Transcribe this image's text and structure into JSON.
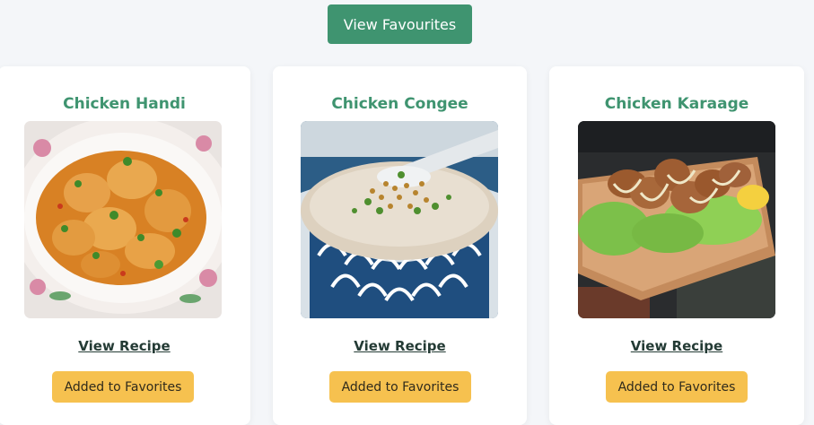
{
  "header": {
    "view_favourites_label": "View Favourites"
  },
  "cards": [
    {
      "title": "Chicken Handi",
      "image_alt": "Chicken Handi dish",
      "view_recipe_label": "View Recipe",
      "favorite_label": "Added to Favorites"
    },
    {
      "title": "Chicken Congee",
      "image_alt": "Chicken Congee bowl",
      "view_recipe_label": "View Recipe",
      "favorite_label": "Added to Favorites"
    },
    {
      "title": "Chicken Karaage",
      "image_alt": "Chicken Karaage on board",
      "view_recipe_label": "View Recipe",
      "favorite_label": "Added to Favorites"
    }
  ],
  "colors": {
    "primary_green": "#3f9470",
    "favorite_yellow": "#f6c14f",
    "page_bg": "#f4f6f9",
    "card_bg": "#ffffff"
  }
}
